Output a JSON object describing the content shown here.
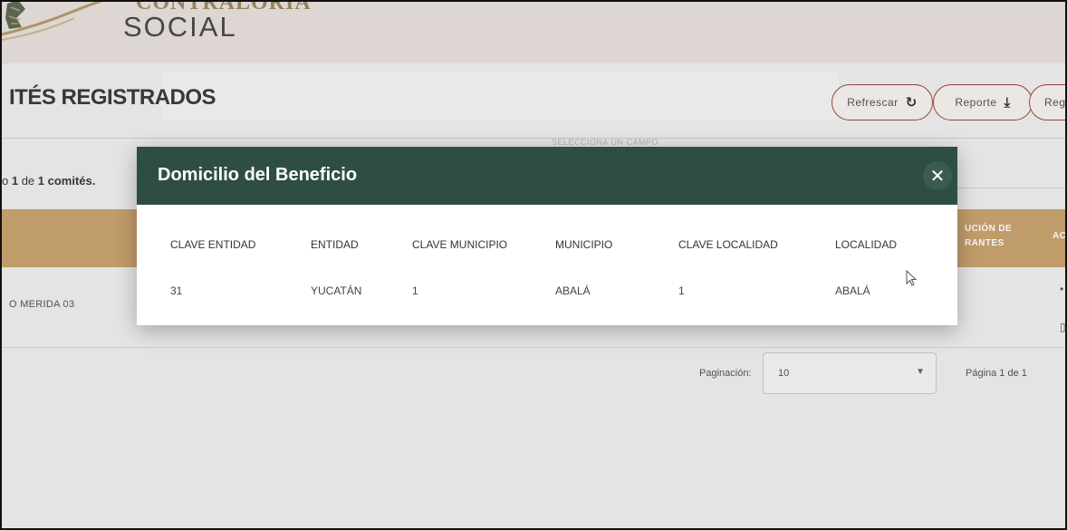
{
  "header": {
    "logo_top_text": "CONTRALORIA",
    "logo_main_text": "SOCIAL",
    "logo_icon": "leaf-emblem-icon"
  },
  "page": {
    "title": "ITÉS REGISTRADOS",
    "select_hint": "SELECCIONA UN CAMPO",
    "count_prefix": "o ",
    "count_bold1": "1",
    "count_mid": " de ",
    "count_bold2": "1 comités.",
    "buttons": {
      "refresh_label": "Refrescar",
      "refresh_icon": "refresh-icon",
      "report_label": "Reporte",
      "report_icon": "download-icon",
      "register_label": "Regi"
    },
    "table_header": {
      "col_a_line1": "UCIÓN DE",
      "col_a_line2": "RANTES",
      "col_b": "AC"
    },
    "row": {
      "name": "O MERIDA 03"
    },
    "pagination": {
      "label": "Paginación:",
      "value": "10",
      "page_text": "Página 1 de 1"
    }
  },
  "modal": {
    "title": "Domicilio del Beneficio",
    "close_symbol": "✕",
    "columns": [
      "CLAVE ENTIDAD",
      "ENTIDAD",
      "CLAVE MUNICIPIO",
      "MUNICIPIO",
      "CLAVE LOCALIDAD",
      "LOCALIDAD"
    ],
    "row": [
      "31",
      "YUCATÁN",
      "1",
      "ABALÁ",
      "1",
      "ABALÁ"
    ]
  },
  "colors": {
    "modal_header": "#2f4e43",
    "table_header": "#c8a36f",
    "button_border": "#9a4a3e"
  }
}
